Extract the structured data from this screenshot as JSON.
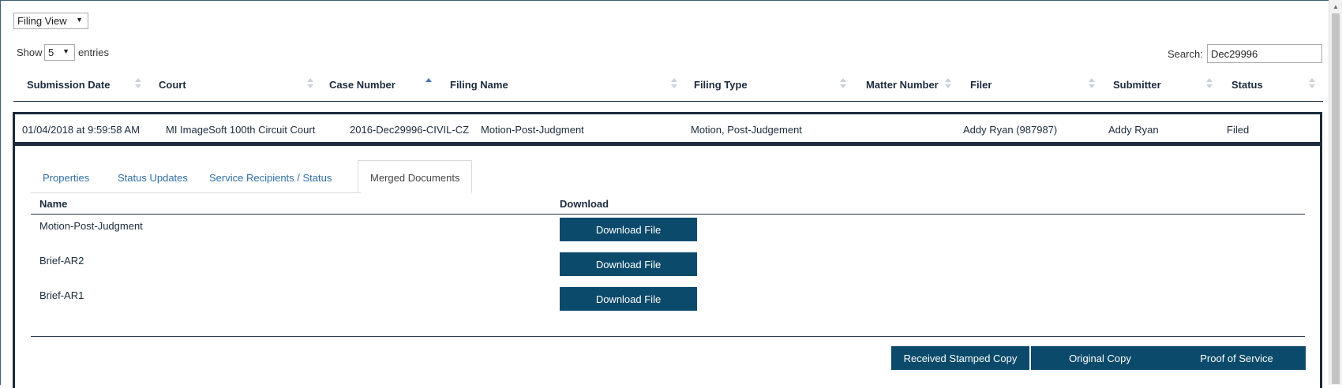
{
  "view_select": {
    "value": "Filing View"
  },
  "length_control": {
    "show": "Show",
    "value": "5",
    "entries": "entries"
  },
  "search": {
    "label": "Search:",
    "value": "Dec29996"
  },
  "columns": [
    "Submission Date",
    "Court",
    "Case Number",
    "Filing Name",
    "Filing Type",
    "Matter Number",
    "Filer",
    "Submitter",
    "Status"
  ],
  "sorted_column": "Case Number",
  "row": {
    "submission_date": "01/04/2018 at 9:59:58 AM",
    "court": "MI ImageSoft 100th Circuit Court",
    "case_number": "2016-Dec29996-CIVIL-CZ",
    "filing_name": "Motion-Post-Judgment",
    "filing_type": "Motion, Post-Judgement",
    "matter_number": "",
    "filer": "Addy Ryan (987987)",
    "submitter": "Addy Ryan",
    "status": "Filed"
  },
  "tabs": [
    "Properties",
    "Status Updates",
    "Service Recipients / Status",
    "Merged Documents"
  ],
  "active_tab": "Merged Documents",
  "documents_table": {
    "headers": {
      "name": "Name",
      "download": "Download"
    },
    "rows": [
      {
        "name": "Motion-Post-Judgment",
        "button": "Download File"
      },
      {
        "name": "Brief-AR2",
        "button": "Download File"
      },
      {
        "name": "Brief-AR1",
        "button": "Download File"
      }
    ]
  },
  "actions": [
    "Received Stamped Copy",
    "Original Copy",
    "Proof of Service"
  ],
  "colors": {
    "primary": "#0b4a6b",
    "text_dark": "#1c2b3e",
    "link": "#2f6fa8",
    "sort_active": "#4a74c9"
  }
}
